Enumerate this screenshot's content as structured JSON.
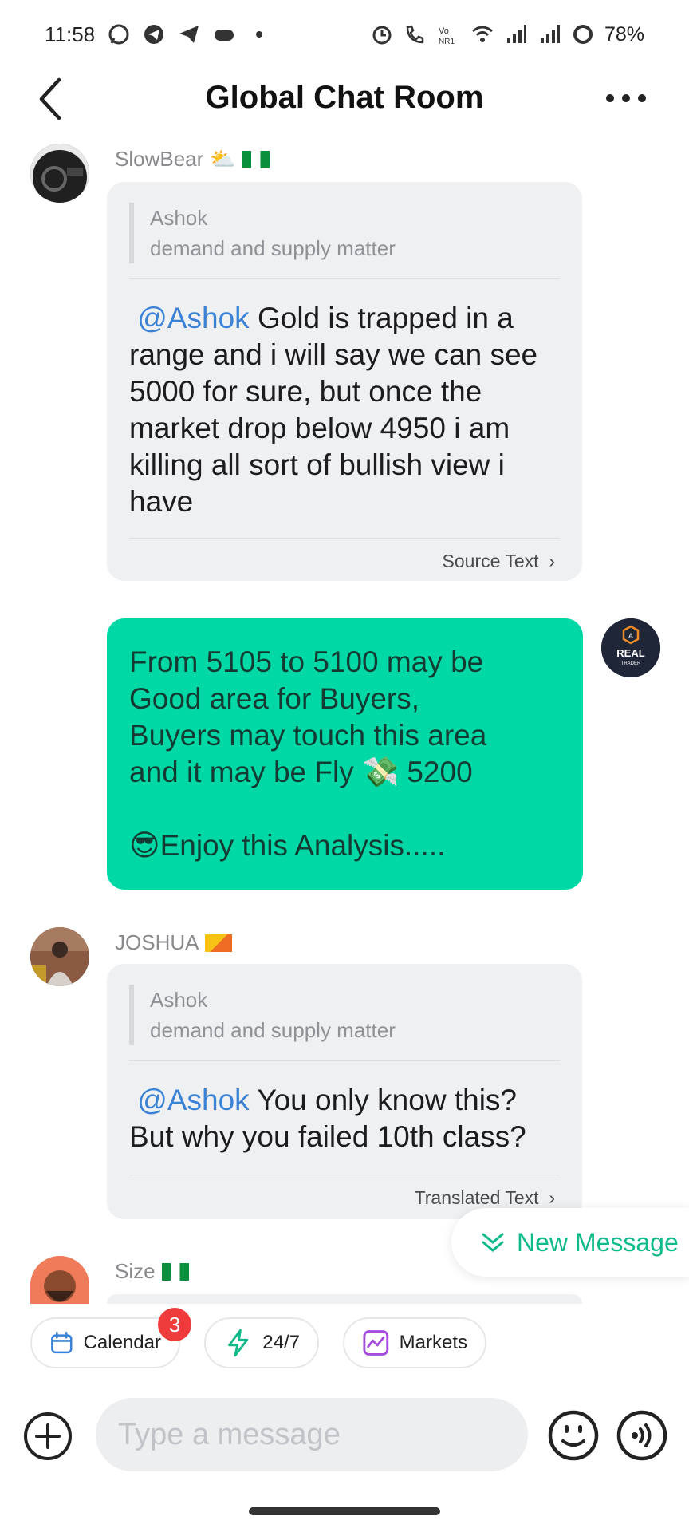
{
  "status_bar": {
    "time": "11:58",
    "battery": "78%"
  },
  "header": {
    "title": "Global Chat Room"
  },
  "messages": [
    {
      "username": "SlowBear",
      "weather_emoji": "⛅",
      "quote_author": "Ashok",
      "quote_text": "demand and supply matter",
      "mention": "@Ashok",
      "text_lines": [
        "Gold is trapped in a",
        "range and i will say we can see",
        "5000 for sure, but once the",
        "market drop below 4950 i am",
        "killing all sort of bullish view i",
        "have"
      ],
      "link": "Source Text"
    },
    {
      "sender_avatar_lines": [
        "REAL",
        "TRADER"
      ],
      "text_lines": [
        "From 5105 to 5100 may be",
        "Good area for Buyers,",
        "Buyers may touch this area",
        "and it may be Fly 💸 5200",
        "",
        "😎Enjoy this Analysis....."
      ]
    },
    {
      "username": "JOSHUA",
      "quote_author": "Ashok",
      "quote_text": "demand and supply matter",
      "mention": "@Ashok",
      "text_lines": [
        "You only know this?",
        "But why you failed 10th class?"
      ],
      "link": "Translated Text"
    },
    {
      "username": "Size"
    }
  ],
  "new_message_label": "New Message",
  "chips": {
    "calendar": "Calendar",
    "calendar_badge": "3",
    "live": "24/7",
    "markets": "Markets"
  },
  "composer": {
    "placeholder": "Type a message"
  },
  "colors": {
    "accent": "#00d9a6",
    "mention": "#3b82d6",
    "badge": "#ef3b3b"
  }
}
